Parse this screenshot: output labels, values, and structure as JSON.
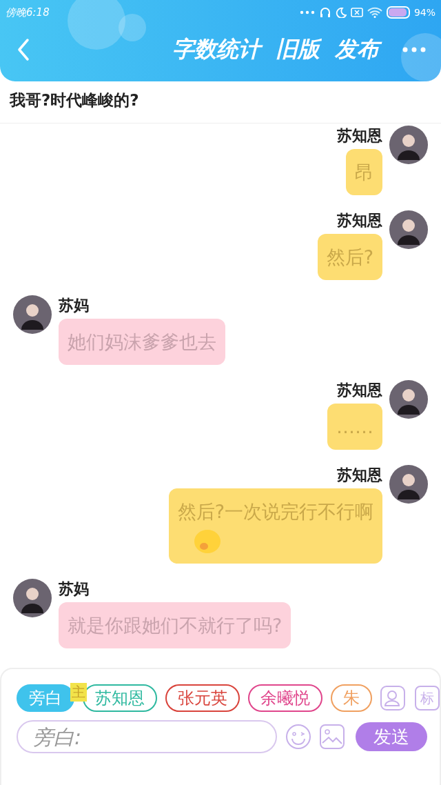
{
  "status_bar": {
    "time": "傍晚6:18",
    "battery_text": "94%"
  },
  "header": {
    "actions": [
      "字数统计",
      "旧版",
      "发布"
    ]
  },
  "quote": {
    "text": "我哥?时代峰峻的?"
  },
  "messages": [
    {
      "kind": "outgoing",
      "name": "苏知恩",
      "text": "昂"
    },
    {
      "kind": "outgoing",
      "name": "苏知恩",
      "text": "然后?"
    },
    {
      "kind": "incoming",
      "name": "苏妈",
      "text": "她们妈沫爹爹也去"
    },
    {
      "kind": "outgoing",
      "name": "苏知恩",
      "text": "……"
    },
    {
      "kind": "outgoing",
      "name": "苏知恩",
      "text": "然后?一次说完行不行啊",
      "emoji": true
    },
    {
      "kind": "incoming",
      "name": "苏妈",
      "text": "就是你跟她们不就行了吗?"
    }
  ],
  "composer": {
    "roles": [
      {
        "label": "旁白",
        "selected": true,
        "color": "#3fc3ec"
      },
      {
        "label": "苏知恩",
        "selected": false,
        "color": "#2fb9a0",
        "badge": "主"
      },
      {
        "label": "张元英",
        "selected": false,
        "color": "#d9443c"
      },
      {
        "label": "余曦悦",
        "selected": false,
        "color": "#e0468c"
      },
      {
        "label": "朱",
        "selected": false,
        "color": "#f0a060"
      }
    ],
    "tag_button": "标",
    "placeholder": "旁白:",
    "send": "发送"
  }
}
